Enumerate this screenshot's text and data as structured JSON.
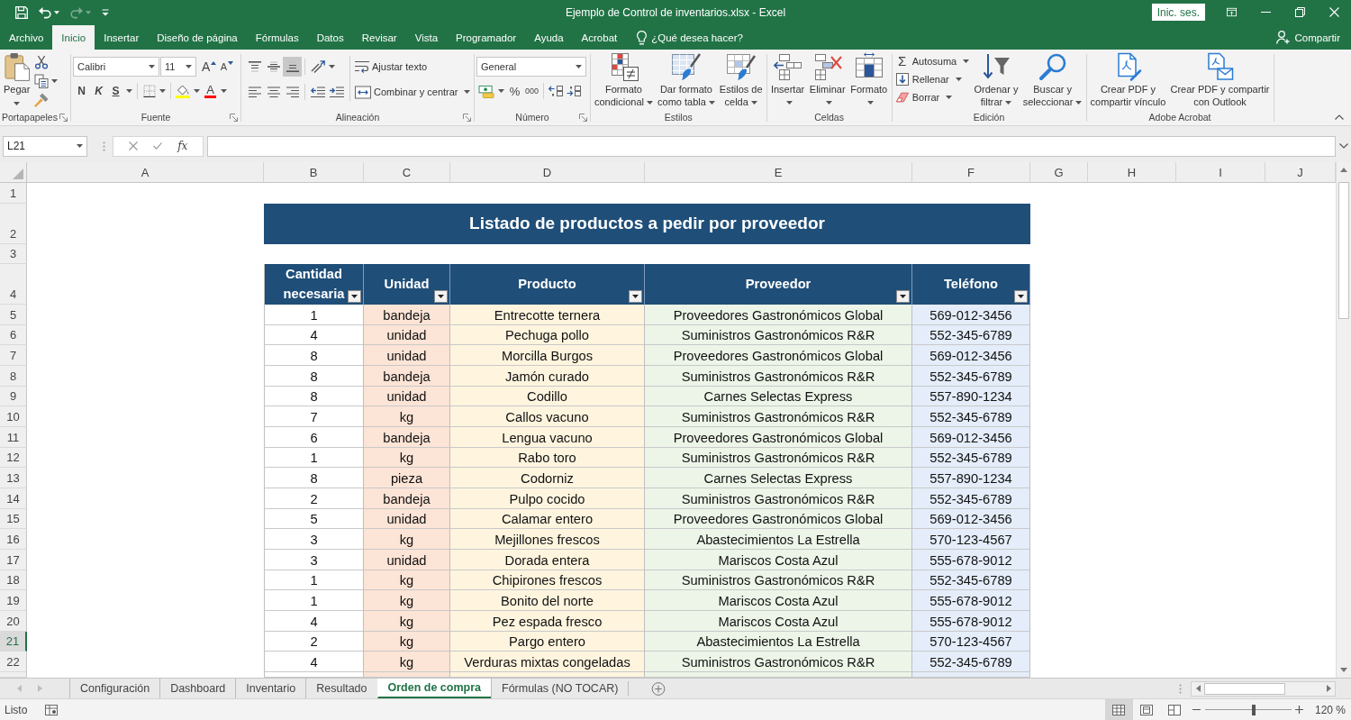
{
  "title_bar": {
    "quick_access": [
      {
        "kind": "save",
        "disabled": false
      },
      {
        "kind": "undo",
        "disabled": false
      },
      {
        "kind": "redo",
        "disabled": true
      },
      {
        "kind": "customize",
        "disabled": false
      }
    ],
    "title": "Ejemplo de Control de inventarios.xlsx - Excel",
    "sign_in": "Inic. ses."
  },
  "ribbon_tabs": [
    {
      "label": "Archivo",
      "selected": false
    },
    {
      "label": "Inicio",
      "selected": true
    },
    {
      "label": "Insertar",
      "selected": false
    },
    {
      "label": "Diseño de página",
      "selected": false
    },
    {
      "label": "Fórmulas",
      "selected": false
    },
    {
      "label": "Datos",
      "selected": false
    },
    {
      "label": "Revisar",
      "selected": false
    },
    {
      "label": "Vista",
      "selected": false
    },
    {
      "label": "Programador",
      "selected": false
    },
    {
      "label": "Ayuda",
      "selected": false
    },
    {
      "label": "Acrobat",
      "selected": false
    }
  ],
  "tell_me": "¿Qué desea hacer?",
  "share": "Compartir",
  "ribbon": {
    "clipboard": {
      "label": "Portapapeles",
      "paste": "Pegar"
    },
    "font": {
      "label": "Fuente",
      "font_name": "Calibri",
      "font_size": "11",
      "grow": "A",
      "shrink": "A",
      "styles": [
        {
          "kind": "bold",
          "label": "N",
          "menu": false
        },
        {
          "kind": "italic",
          "label": "K",
          "menu": false
        },
        {
          "kind": "underline",
          "label": "S",
          "menu": true
        }
      ],
      "font_color": "A"
    },
    "alignment": {
      "label": "Alineación",
      "vertical": [
        {
          "kind": "top",
          "selected": false
        },
        {
          "kind": "middle",
          "selected": false
        },
        {
          "kind": "bottom",
          "selected": true
        }
      ],
      "horizontal": [
        {
          "kind": "left",
          "selected": false
        },
        {
          "kind": "center",
          "selected": false
        },
        {
          "kind": "right",
          "selected": false
        }
      ],
      "wrap_text": "Ajustar texto",
      "merge_center": "Combinar y centrar"
    },
    "number": {
      "label": "Número",
      "format": "General",
      "percent": "%",
      "thousands": "000"
    },
    "styles": {
      "label": "Estilos",
      "buttons": [
        {
          "kind": "conditional",
          "lines": [
            "Formato",
            "condicional"
          ],
          "menu": true
        },
        {
          "kind": "table",
          "lines": [
            "Dar formato",
            "como tabla"
          ],
          "menu": true
        },
        {
          "kind": "cell_styles",
          "lines": [
            "Estilos de",
            "celda"
          ],
          "menu": true
        }
      ]
    },
    "cells": {
      "label": "Celdas",
      "buttons": [
        {
          "kind": "insert",
          "lines": [
            "Insertar"
          ],
          "menu": true
        },
        {
          "kind": "delete",
          "lines": [
            "Eliminar"
          ],
          "menu": true
        },
        {
          "kind": "format",
          "lines": [
            "Formato"
          ],
          "menu": true
        }
      ]
    },
    "editing": {
      "label": "Edición",
      "commands": [
        {
          "kind": "autosum",
          "symbol": "Σ",
          "label": "Autosuma",
          "menu": true
        },
        {
          "kind": "fill",
          "label": "Rellenar",
          "menu": true
        },
        {
          "kind": "clear",
          "label": "Borrar",
          "menu": true
        }
      ],
      "buttons": [
        {
          "kind": "sort",
          "lines": [
            "Ordenar y",
            "filtrar"
          ],
          "menu": true
        },
        {
          "kind": "find",
          "lines": [
            "Buscar y",
            "seleccionar"
          ],
          "menu": true
        }
      ]
    },
    "acrobat": {
      "label": "Adobe Acrobat",
      "buttons": [
        {
          "kind": "pdf_link",
          "lines": [
            "Crear PDF y",
            "compartir vínculo"
          ],
          "menu": false
        },
        {
          "kind": "pdf_outlook",
          "lines": [
            "Crear PDF y compartir",
            "con Outlook"
          ],
          "menu": false
        }
      ]
    }
  },
  "formula_bar": {
    "name_box": "L21",
    "function_label": "fx"
  },
  "sheet": {
    "column_headers": [
      "A",
      "B",
      "C",
      "D",
      "E",
      "F",
      "G",
      "H",
      "I",
      "J"
    ],
    "rows": [
      {
        "header": {
          "label": "1",
          "selected": false
        },
        "kind": "blank"
      },
      {
        "header": {
          "label": "2",
          "selected": false
        },
        "kind": "title",
        "title": "Listado de productos a pedir por proveedor"
      },
      {
        "header": {
          "label": "3",
          "selected": false
        },
        "kind": "blank"
      },
      {
        "header": {
          "label": "4",
          "selected": false
        },
        "kind": "table_header",
        "cells": [
          "Cantidad necesaria",
          "Unidad",
          "Producto",
          "Proveedor",
          "Teléfono"
        ]
      },
      {
        "header": {
          "label": "5",
          "selected": false
        },
        "kind": "data",
        "cells": [
          "1",
          "bandeja",
          "Entrecotte ternera",
          "Proveedores Gastronómicos Global",
          "569-012-3456"
        ]
      },
      {
        "header": {
          "label": "6",
          "selected": false
        },
        "kind": "data",
        "cells": [
          "4",
          "unidad",
          "Pechuga pollo",
          "Suministros Gastronómicos R&R",
          "552-345-6789"
        ]
      },
      {
        "header": {
          "label": "7",
          "selected": false
        },
        "kind": "data",
        "cells": [
          "8",
          "unidad",
          "Morcilla Burgos",
          "Proveedores Gastronómicos Global",
          "569-012-3456"
        ]
      },
      {
        "header": {
          "label": "8",
          "selected": false
        },
        "kind": "data",
        "cells": [
          "8",
          "bandeja",
          "Jamón curado",
          "Suministros Gastronómicos R&R",
          "552-345-6789"
        ]
      },
      {
        "header": {
          "label": "9",
          "selected": false
        },
        "kind": "data",
        "cells": [
          "8",
          "unidad",
          "Codillo",
          "Carnes Selectas Express",
          "557-890-1234"
        ]
      },
      {
        "header": {
          "label": "10",
          "selected": false
        },
        "kind": "data",
        "cells": [
          "7",
          "kg",
          "Callos vacuno",
          "Suministros Gastronómicos R&R",
          "552-345-6789"
        ]
      },
      {
        "header": {
          "label": "11",
          "selected": false
        },
        "kind": "data",
        "cells": [
          "6",
          "bandeja",
          "Lengua vacuno",
          "Proveedores Gastronómicos Global",
          "569-012-3456"
        ]
      },
      {
        "header": {
          "label": "12",
          "selected": false
        },
        "kind": "data",
        "cells": [
          "1",
          "kg",
          "Rabo toro",
          "Suministros Gastronómicos R&R",
          "552-345-6789"
        ]
      },
      {
        "header": {
          "label": "13",
          "selected": false
        },
        "kind": "data",
        "cells": [
          "8",
          "pieza",
          "Codorniz",
          "Carnes Selectas Express",
          "557-890-1234"
        ]
      },
      {
        "header": {
          "label": "14",
          "selected": false
        },
        "kind": "data",
        "cells": [
          "2",
          "bandeja",
          "Pulpo cocido",
          "Suministros Gastronómicos R&R",
          "552-345-6789"
        ]
      },
      {
        "header": {
          "label": "15",
          "selected": false
        },
        "kind": "data",
        "cells": [
          "5",
          "unidad",
          "Calamar entero",
          "Proveedores Gastronómicos Global",
          "569-012-3456"
        ]
      },
      {
        "header": {
          "label": "16",
          "selected": false
        },
        "kind": "data",
        "cells": [
          "3",
          "kg",
          "Mejillones frescos",
          "Abastecimientos La Estrella",
          "570-123-4567"
        ]
      },
      {
        "header": {
          "label": "17",
          "selected": false
        },
        "kind": "data",
        "cells": [
          "3",
          "unidad",
          "Dorada entera",
          "Mariscos Costa Azul",
          "555-678-9012"
        ]
      },
      {
        "header": {
          "label": "18",
          "selected": false
        },
        "kind": "data",
        "cells": [
          "1",
          "kg",
          "Chipirones frescos",
          "Suministros Gastronómicos R&R",
          "552-345-6789"
        ]
      },
      {
        "header": {
          "label": "19",
          "selected": false
        },
        "kind": "data",
        "cells": [
          "1",
          "kg",
          "Bonito del norte",
          "Mariscos Costa Azul",
          "555-678-9012"
        ]
      },
      {
        "header": {
          "label": "20",
          "selected": false
        },
        "kind": "data",
        "cells": [
          "4",
          "kg",
          "Pez espada fresco",
          "Mariscos Costa Azul",
          "555-678-9012"
        ]
      },
      {
        "header": {
          "label": "21",
          "selected": true
        },
        "kind": "data",
        "cells": [
          "2",
          "kg",
          "Pargo entero",
          "Abastecimientos La Estrella",
          "570-123-4567"
        ]
      },
      {
        "header": {
          "label": "22",
          "selected": false
        },
        "kind": "data",
        "cells": [
          "4",
          "kg",
          "Verduras mixtas congeladas",
          "Suministros Gastronómicos R&R",
          "552-345-6789"
        ]
      }
    ]
  },
  "sheet_tabs": [
    {
      "label": "Configuración",
      "selected": false
    },
    {
      "label": "Dashboard",
      "selected": false
    },
    {
      "label": "Inventario",
      "selected": false
    },
    {
      "label": "Resultado",
      "selected": false
    },
    {
      "label": "Orden de compra",
      "selected": true
    },
    {
      "label": "Fórmulas (NO TOCAR)",
      "selected": false
    }
  ],
  "status_bar": {
    "status": "Listo",
    "views": [
      {
        "kind": "normal",
        "selected": true
      },
      {
        "kind": "page_layout",
        "selected": false
      },
      {
        "kind": "page_break",
        "selected": false
      }
    ],
    "zoom": {
      "level": 0.56,
      "reading": "120 %"
    }
  }
}
